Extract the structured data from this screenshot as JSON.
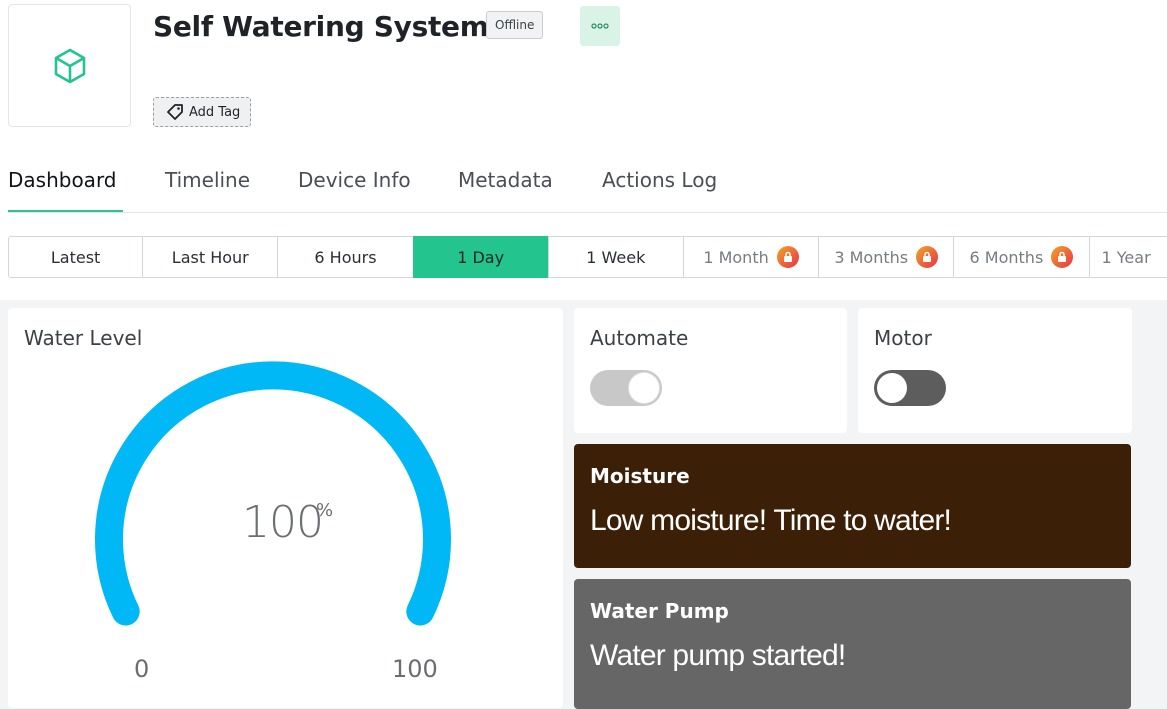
{
  "device": {
    "title": "Self Watering System",
    "status": "Offline",
    "add_tag_label": "Add Tag"
  },
  "tabs": [
    {
      "label": "Dashboard",
      "active": true
    },
    {
      "label": "Timeline"
    },
    {
      "label": "Device Info"
    },
    {
      "label": "Metadata"
    },
    {
      "label": "Actions Log"
    }
  ],
  "time_ranges": [
    {
      "label": "Latest"
    },
    {
      "label": "Last Hour"
    },
    {
      "label": "6 Hours"
    },
    {
      "label": "1 Day",
      "active": true
    },
    {
      "label": "1 Week"
    },
    {
      "label": "1 Month",
      "locked": true
    },
    {
      "label": "3 Months",
      "locked": true
    },
    {
      "label": "6 Months",
      "locked": true
    },
    {
      "label": "1 Year"
    }
  ],
  "widgets": {
    "water_level": {
      "title": "Water Level",
      "value": "100",
      "unit": "%",
      "min": "0",
      "max": "100",
      "fraction": 1.0,
      "color": "#00b8f5"
    },
    "automate": {
      "title": "Automate",
      "state": "on"
    },
    "motor": {
      "title": "Motor",
      "state": "off"
    },
    "moisture": {
      "title": "Moisture",
      "message": "Low moisture! Time to water!",
      "color": "#3b1f06"
    },
    "water_pump": {
      "title": "Water Pump",
      "message": "Water pump started!",
      "color": "#666666"
    }
  },
  "colors": {
    "accent": "#23c48e",
    "lock_badge": "#e8503a"
  },
  "icons": {
    "device": "cube-icon",
    "more": "more-dots-icon",
    "tag": "tag-icon",
    "lock": "lock-icon"
  }
}
